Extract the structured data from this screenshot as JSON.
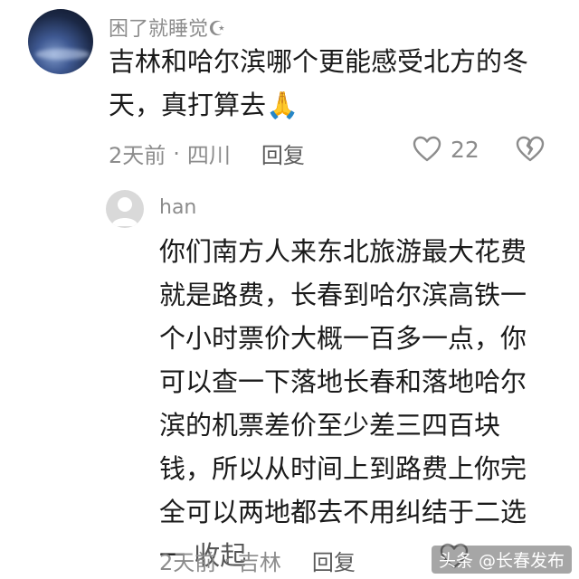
{
  "comment": {
    "username": "困了就睡觉☪",
    "text": "吉林和哈尔滨哪个更能感受北方的冬天，真打算去🙏",
    "line1": "吉林和哈尔滨哪个更能感受北方的冬",
    "line2": "天，真打算去",
    "emoji": "🙏",
    "time": "2天前",
    "location": "四川",
    "reply_label": "回复",
    "like_count": "22",
    "like_icon": "heart-outline-icon",
    "dislike_icon": "broken-heart-icon"
  },
  "reply": {
    "username": "han",
    "lines": [
      "你们南方人来东北旅游最大花费",
      "就是路费，长春到哈尔滨高铁一",
      "个小时票价大概一百多一点，你",
      "可以查一下落地长春和落地哈尔",
      "滨的机票差价至少差三四百块",
      "钱，所以从时间上到路费上你完",
      "全可以两地都去不用纠结于二选",
      "一"
    ],
    "collapse_label": "收起",
    "time": "2天前",
    "location": "吉林",
    "reply_label": "回复"
  },
  "watermark": "头条 @长春发布",
  "separator": "·"
}
